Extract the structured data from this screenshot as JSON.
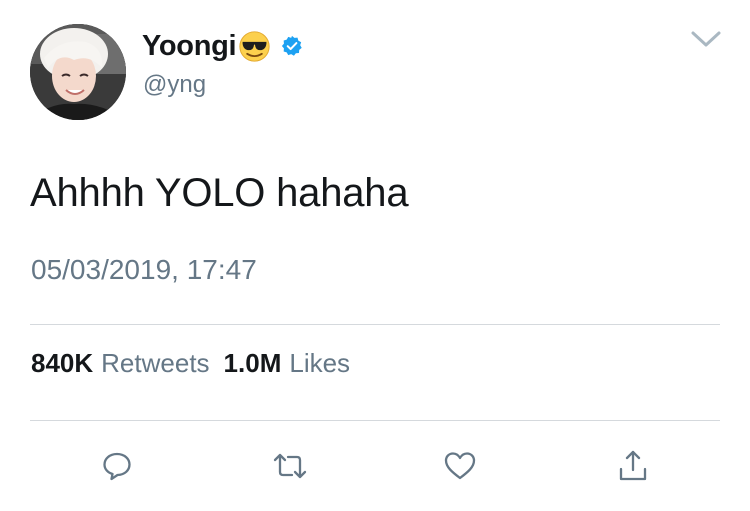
{
  "user": {
    "display_name": "Yoongi",
    "display_emoji": "smiling-face-with-sunglasses",
    "verified": true,
    "handle": "@yng",
    "avatar": "profile-photo"
  },
  "tweet": {
    "text": "Ahhhh YOLO hahaha",
    "timestamp": "05/03/2019, 17:47"
  },
  "stats": {
    "retweets_count": "840K",
    "retweets_label": "Retweets",
    "likes_count": "1.0M",
    "likes_label": "Likes"
  },
  "actions": [
    {
      "icon": "reply-icon"
    },
    {
      "icon": "retweet-icon"
    },
    {
      "icon": "like-icon"
    },
    {
      "icon": "share-icon"
    }
  ],
  "colors": {
    "text_primary": "#14171a",
    "text_secondary": "#657786",
    "verified_blue": "#1da1f2",
    "divider": "#d5d9dd"
  }
}
